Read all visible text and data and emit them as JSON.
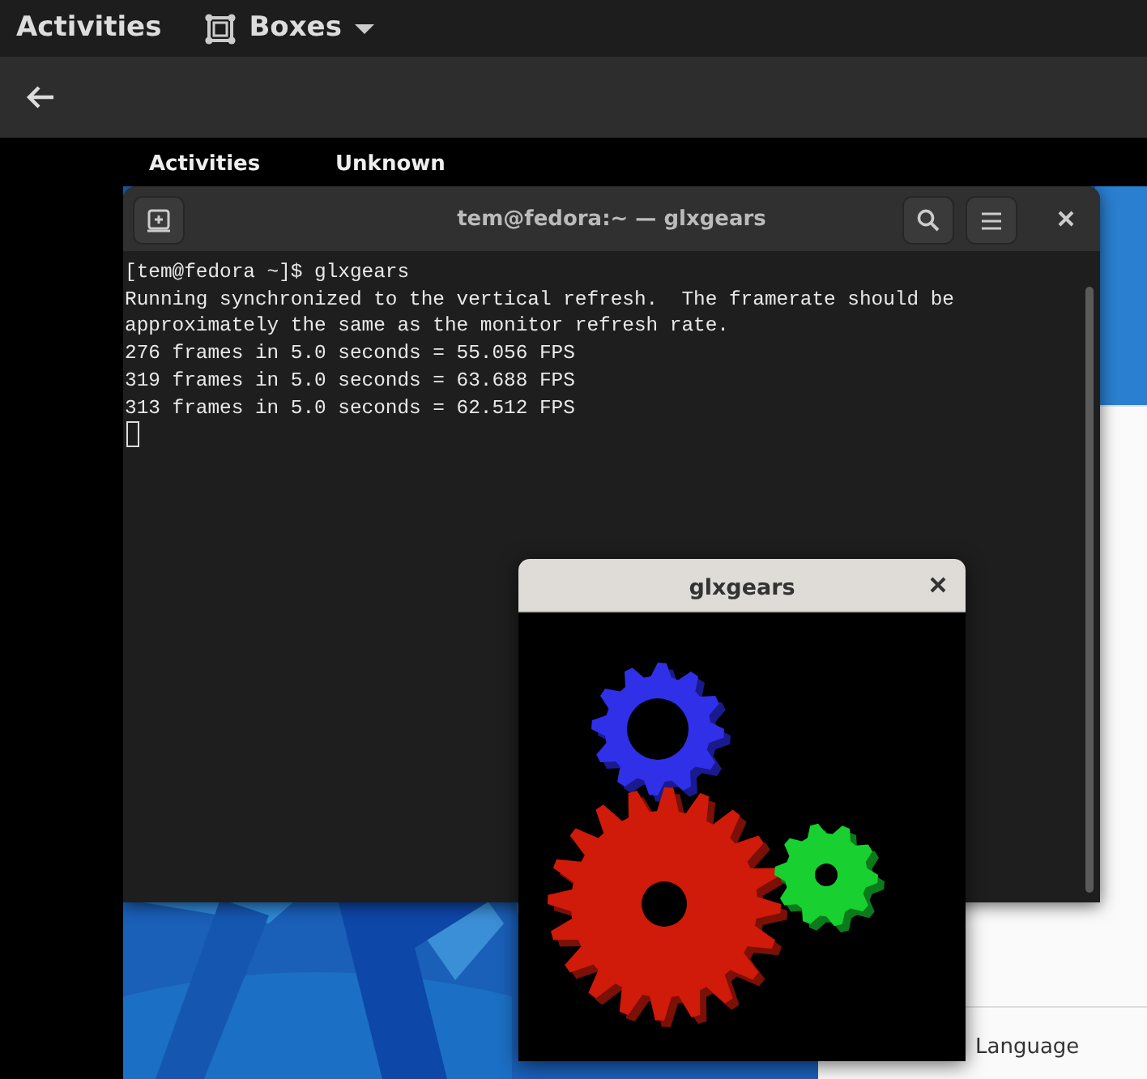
{
  "top_bar": {
    "activities": "Activities",
    "app_name": "Boxes"
  },
  "guest": {
    "top_bar": {
      "activities": "Activities",
      "app_menu": "Unknown"
    },
    "background_window": {
      "visible_text": "Language"
    }
  },
  "terminal": {
    "title": "tem@fedora:~ — glxgears",
    "lines": [
      "[tem@fedora ~]$ glxgears",
      "Running synchronized to the vertical refresh.  The framerate should be",
      "approximately the same as the monitor refresh rate.",
      "276 frames in 5.0 seconds = 55.056 FPS",
      "319 frames in 5.0 seconds = 63.688 FPS",
      "313 frames in 5.0 seconds = 62.512 FPS"
    ]
  },
  "glxgears": {
    "title": "glxgears"
  }
}
